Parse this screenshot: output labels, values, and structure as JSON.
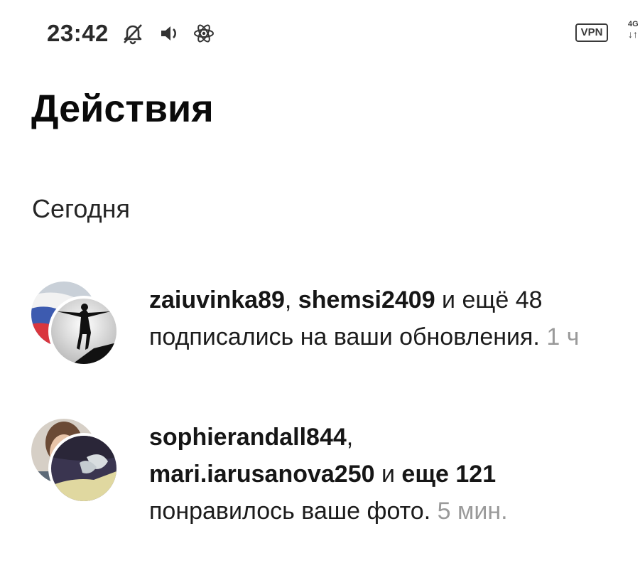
{
  "status_bar": {
    "time": "23:42",
    "icons": [
      "silent-bell-icon",
      "volume-icon",
      "atom-icon"
    ],
    "vpn_label": "VPN",
    "network_type": "4G",
    "network_arrows": "↓↑"
  },
  "header": {
    "title": "Действия"
  },
  "section": {
    "label": "Сегодня"
  },
  "activities": [
    {
      "user1": "zaiuvinka89",
      "sep1": ", ",
      "user2": "shemsi2409",
      "more": " и ещё 48",
      "action": "подписались на ваши обновления.",
      "time": "1 ч"
    },
    {
      "user1": "sophierandall844",
      "sep1": ",",
      "user2": "mari.iarusanova250",
      "and": " и ",
      "more_bold": "еще 121",
      "action": "понравилось ваше фото.",
      "time": "5 мин."
    }
  ],
  "colors": {
    "text": "#111111",
    "timestamp": "#9a9a9a",
    "background": "#ffffff"
  }
}
